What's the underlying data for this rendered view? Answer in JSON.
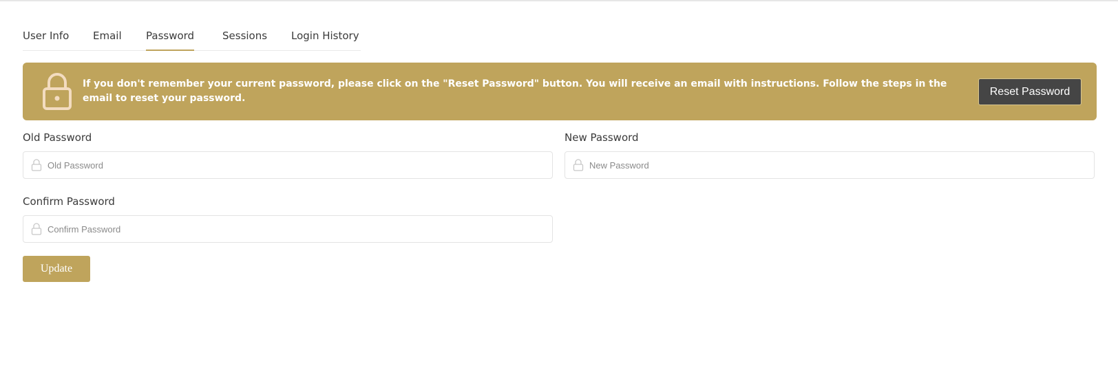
{
  "tabs": [
    {
      "label": "User Info",
      "active": false
    },
    {
      "label": "Email",
      "active": false
    },
    {
      "label": "Password",
      "active": true
    },
    {
      "label": "Sessions",
      "active": false
    },
    {
      "label": "Login History",
      "active": false
    }
  ],
  "alert": {
    "message": "If you don't remember your current password, please click on the \"Reset Password\" button. You will receive an email with instructions. Follow the steps in the email to reset your password.",
    "button_label": "Reset Password",
    "icon": "lock-icon"
  },
  "form": {
    "old_password": {
      "label": "Old Password",
      "placeholder": "Old Password",
      "value": "",
      "icon": "lock-icon"
    },
    "new_password": {
      "label": "New Password",
      "placeholder": "New Password",
      "value": "",
      "icon": "lock-icon"
    },
    "confirm_password": {
      "label": "Confirm Password",
      "placeholder": "Confirm Password",
      "value": "",
      "icon": "lock-icon"
    },
    "submit_label": "Update"
  },
  "colors": {
    "accent": "#bfa45c",
    "dark_button": "#454545",
    "lock_icon_light": "#f3dcc0",
    "lock_icon_input": "#c8c8c8"
  }
}
